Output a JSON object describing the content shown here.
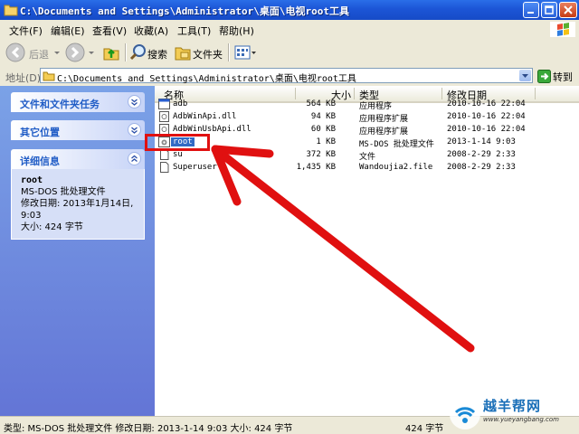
{
  "window": {
    "title": "C:\\Documents and Settings\\Administrator\\桌面\\电视root工具"
  },
  "menu": [
    "文件(F)",
    "编辑(E)",
    "查看(V)",
    "收藏(A)",
    "工具(T)",
    "帮助(H)"
  ],
  "toolbar": {
    "back": "后退",
    "search": "搜索",
    "folders": "文件夹"
  },
  "address": {
    "label": "地址(D)",
    "value": "C:\\Documents and Settings\\Administrator\\桌面\\电视root工具",
    "go": "转到"
  },
  "left_pane": {
    "tasks_title": "文件和文件夹任务",
    "other_title": "其它位置",
    "details_title": "详细信息",
    "details": {
      "name": "root",
      "type": "MS-DOS 批处理文件",
      "modified": "修改日期: 2013年1月14日, 9:03",
      "size": "大小: 424 字节"
    }
  },
  "columns": {
    "name": "名称",
    "size": "大小",
    "type": "类型",
    "modified": "修改日期"
  },
  "files": [
    {
      "name": "adb",
      "size": "564 KB",
      "type": "应用程序",
      "modified": "2010-10-16 22:04",
      "icon": "exe-icon"
    },
    {
      "name": "AdbWinApi.dll",
      "size": "94 KB",
      "type": "应用程序扩展",
      "modified": "2010-10-16 22:04",
      "icon": "dll-icon"
    },
    {
      "name": "AdbWinUsbApi.dll",
      "size": "60 KB",
      "type": "应用程序扩展",
      "modified": "2010-10-16 22:04",
      "icon": "dll-icon"
    },
    {
      "name": "root",
      "size": "1 KB",
      "type": "MS-DOS 批处理文件",
      "modified": "2013-1-14 9:03",
      "icon": "bat-icon"
    },
    {
      "name": "su",
      "size": "372 KB",
      "type": "文件",
      "modified": "2008-2-29 2:33",
      "icon": "file-icon"
    },
    {
      "name": "Superuser",
      "size": "1,435 KB",
      "type": "Wandoujia2.file",
      "modified": "2008-2-29 2:33",
      "icon": "file-icon"
    }
  ],
  "status": {
    "text": "类型: MS-DOS 批处理文件 修改日期: 2013-1-14 9:03 大小: 424 字节",
    "size": "424 字节"
  },
  "watermark": {
    "title": "越羊帮网",
    "url": "www.yueyangbang.com"
  },
  "colors": {
    "titlebar": "#1c55d6",
    "left_pane": "#6f8ee0",
    "highlight": "#e01010",
    "selection": "#316ac5"
  }
}
